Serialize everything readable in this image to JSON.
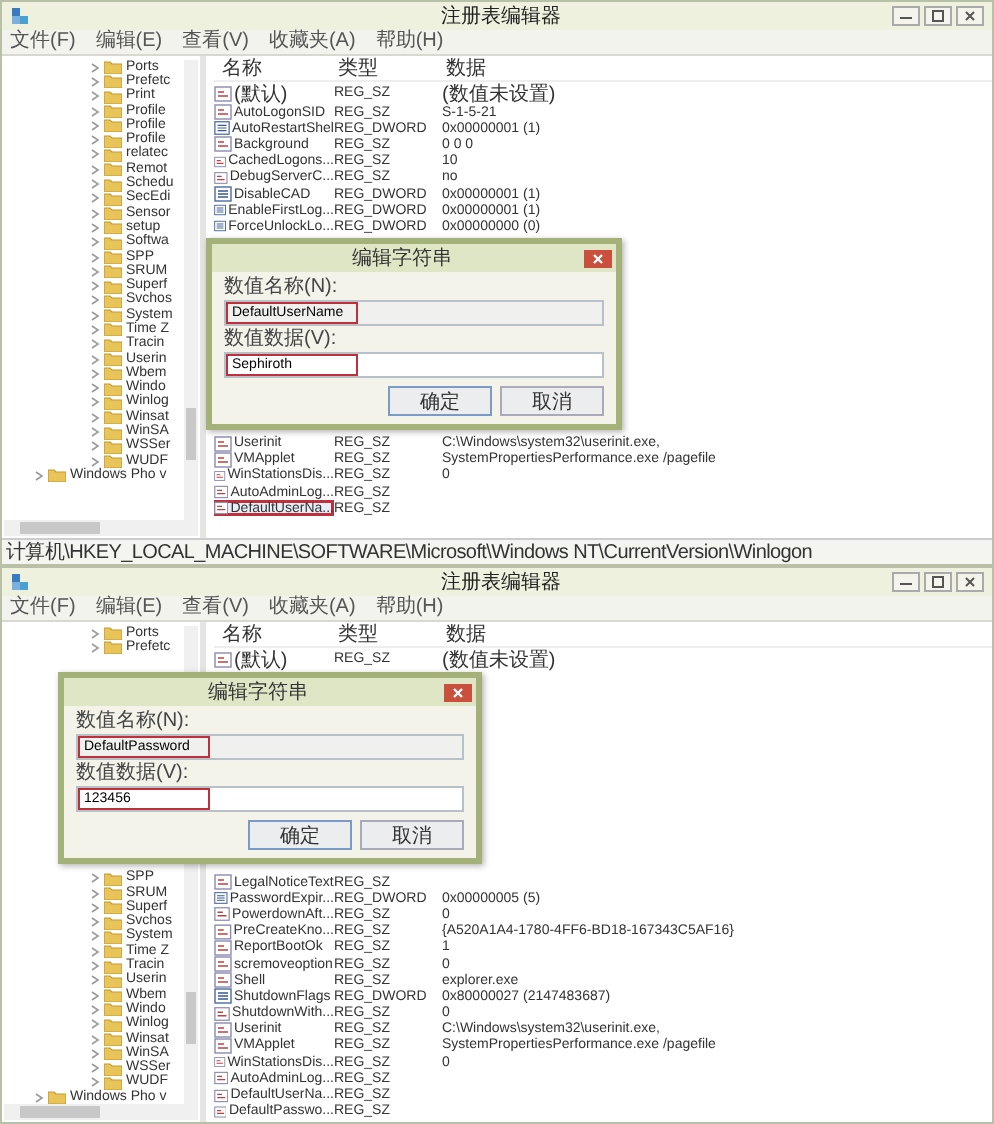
{
  "windows": [
    {
      "title": "注册表编辑器",
      "menu": [
        "文件(F)",
        "编辑(E)",
        "查看(V)",
        "收藏夹(A)",
        "帮助(H)"
      ],
      "tree": {
        "children": [
          "Ports",
          "Prefetc",
          "Print",
          "Profile",
          "Profile",
          "Profile",
          "relatec",
          "Remot",
          "Schedu",
          "SecEdi",
          "Sensor",
          "setup",
          "Softwa",
          "SPP",
          "SRUM",
          "Superf",
          "Svchos",
          "System",
          "Time Z",
          "Tracin",
          "Userin",
          "Wbem",
          "Windo",
          "Winlog",
          "Winsat",
          "WinSA",
          "WSSer",
          "WUDF"
        ],
        "siblings": [
          "Windows Pho v"
        ]
      },
      "columns": [
        "名称",
        "类型",
        "数据"
      ],
      "rows": [
        {
          "kind": "string",
          "name": "(默认)",
          "type": "REG_SZ",
          "data": "(数值未设置)",
          "highlighted": false
        },
        {
          "kind": "string",
          "name": "AutoLogonSID",
          "type": "REG_SZ",
          "data": "S-1-5-21",
          "highlighted": false
        },
        {
          "kind": "dword",
          "name": "AutoRestartShel",
          "type": "REG_DWORD",
          "data": "0x00000001 (1)",
          "highlighted": false
        },
        {
          "kind": "string",
          "name": "Background",
          "type": "REG_SZ",
          "data": "0 0 0",
          "highlighted": false
        },
        {
          "kind": "string",
          "name": "CachedLogons...",
          "type": "REG_SZ",
          "data": "10",
          "highlighted": false
        },
        {
          "kind": "string",
          "name": "DebugServerC...",
          "type": "REG_SZ",
          "data": "no",
          "highlighted": false
        },
        {
          "kind": "dword",
          "name": "DisableCAD",
          "type": "REG_DWORD",
          "data": "0x00000001 (1)",
          "highlighted": false
        },
        {
          "kind": "dword",
          "name": "EnableFirstLog...",
          "type": "REG_DWORD",
          "data": "0x00000001 (1)",
          "highlighted": false
        },
        {
          "kind": "dword",
          "name": "ForceUnlockLo...",
          "type": "REG_DWORD",
          "data": "0x00000000 (0)",
          "highlighted": false
        }
      ],
      "after_dialog_rows": [
        {
          "kind": "string",
          "name": "Userinit",
          "type": "REG_SZ",
          "data": "C:\\Windows\\system32\\userinit.exe,",
          "highlighted": false
        },
        {
          "kind": "string",
          "name": "VMApplet",
          "type": "REG_SZ",
          "data": "SystemPropertiesPerformance.exe /pagefile",
          "highlighted": false
        },
        {
          "kind": "string",
          "name": "WinStationsDis...",
          "type": "REG_SZ",
          "data": "0",
          "highlighted": false
        },
        {
          "kind": "string",
          "name": "AutoAdminLog...",
          "type": "REG_SZ",
          "data": "",
          "highlighted": false
        },
        {
          "kind": "string",
          "name": "DefaultUserNa...",
          "type": "REG_SZ",
          "data": "",
          "highlighted": true
        }
      ],
      "dialog": {
        "title": "编辑字符串",
        "name_label": "数值名称(N):",
        "name_value": "DefaultUserName",
        "name_highlighted": true,
        "data_label": "数值数据(V):",
        "data_value": "Sephiroth",
        "data_highlighted": true,
        "buttons": [
          "确定",
          "取消"
        ]
      },
      "status_bar": "计算机\\HKEY_LOCAL_MACHINE\\SOFTWARE\\Microsoft\\Windows NT\\CurrentVersion\\Winlogon"
    },
    {
      "title": "注册表编辑器",
      "menu": [
        "文件(F)",
        "编辑(E)",
        "查看(V)",
        "收藏夹(A)",
        "帮助(H)"
      ],
      "tree": {
        "children": [
          "Ports",
          "Prefetc"
        ],
        "after_dialog_children": [
          "SPP",
          "SRUM",
          "Superf",
          "Svchos",
          "System",
          "Time Z",
          "Tracin",
          "Userin",
          "Wbem",
          "Windo",
          "Winlog",
          "Winsat",
          "WinSA",
          "WSSer",
          "WUDF"
        ],
        "siblings": [
          "Windows Pho v"
        ]
      },
      "columns": [
        "名称",
        "类型",
        "数据"
      ],
      "rows": [
        {
          "kind": "string",
          "name": "(默认)",
          "type": "REG_SZ",
          "data": "(数值未设置)",
          "highlighted": false
        }
      ],
      "after_dialog_rows": [
        {
          "kind": "string",
          "name": "LegalNoticeText",
          "type": "REG_SZ",
          "data": "",
          "highlighted": false
        },
        {
          "kind": "dword",
          "name": "PasswordExpir...",
          "type": "REG_DWORD",
          "data": "0x00000005 (5)",
          "highlighted": false
        },
        {
          "kind": "string",
          "name": "PowerdownAft...",
          "type": "REG_SZ",
          "data": "0",
          "highlighted": false
        },
        {
          "kind": "string",
          "name": "PreCreateKno...",
          "type": "REG_SZ",
          "data": "{A520A1A4-1780-4FF6-BD18-167343C5AF16}",
          "highlighted": false
        },
        {
          "kind": "string",
          "name": "ReportBootOk",
          "type": "REG_SZ",
          "data": "1",
          "highlighted": false
        },
        {
          "kind": "string",
          "name": "scremoveoption",
          "type": "REG_SZ",
          "data": "0",
          "highlighted": false
        },
        {
          "kind": "string",
          "name": "Shell",
          "type": "REG_SZ",
          "data": "explorer.exe",
          "highlighted": false
        },
        {
          "kind": "dword",
          "name": "ShutdownFlags",
          "type": "REG_DWORD",
          "data": "0x80000027 (2147483687)",
          "highlighted": false
        },
        {
          "kind": "string",
          "name": "ShutdownWith...",
          "type": "REG_SZ",
          "data": "0",
          "highlighted": false
        },
        {
          "kind": "string",
          "name": "Userinit",
          "type": "REG_SZ",
          "data": "C:\\Windows\\system32\\userinit.exe,",
          "highlighted": false
        },
        {
          "kind": "string",
          "name": "VMApplet",
          "type": "REG_SZ",
          "data": "SystemPropertiesPerformance.exe /pagefile",
          "highlighted": false
        },
        {
          "kind": "string",
          "name": "WinStationsDis...",
          "type": "REG_SZ",
          "data": "0",
          "highlighted": false
        },
        {
          "kind": "string",
          "name": "AutoAdminLog...",
          "type": "REG_SZ",
          "data": "",
          "highlighted": false
        },
        {
          "kind": "string",
          "name": "DefaultUserNa...",
          "type": "REG_SZ",
          "data": "",
          "highlighted": false
        },
        {
          "kind": "string",
          "name": "DefaultPasswo...",
          "type": "REG_SZ",
          "data": "",
          "highlighted": false
        }
      ],
      "dialog": {
        "title": "编辑字符串",
        "name_label": "数值名称(N):",
        "name_value": "DefaultPassword",
        "name_highlighted": true,
        "data_label": "数值数据(V):",
        "data_value": "123456",
        "data_highlighted": true,
        "buttons": [
          "确定",
          "取消"
        ]
      }
    }
  ]
}
